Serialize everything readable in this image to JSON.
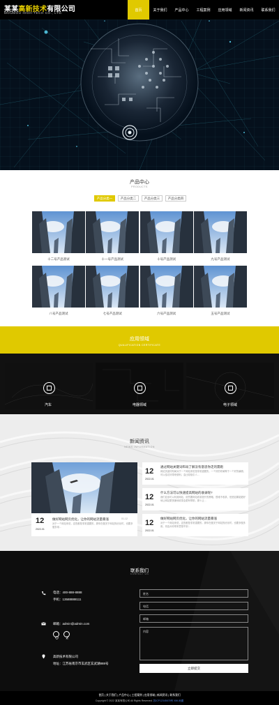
{
  "header": {
    "logo_prefix": "某某",
    "logo_highlight": "高新技术",
    "logo_suffix": "有限公司",
    "logo_sub": "MOUMOU HIGH-TECH CO., LTD.",
    "nav": [
      "首页",
      "关于我们",
      "产品中心",
      "工程案例",
      "应用领域",
      "新闻资讯",
      "联系我们"
    ],
    "active_nav_index": 0
  },
  "products": {
    "title": "产品中心",
    "subtitle": "PRODUCTS",
    "tabs": [
      "产品分类一",
      "产品分类二",
      "产品分类三",
      "产品分类四"
    ],
    "active_tab_index": 0,
    "items": [
      "十二号产品测试",
      "十一号产品测试",
      "十号产品测试",
      "九号产品测试",
      "八号产品测试",
      "七号产品测试",
      "六号产品测试",
      "五号产品测试"
    ]
  },
  "application": {
    "title": "应用领域",
    "subtitle": "QUALIFICATION CERTIFICATE",
    "items": [
      "汽车",
      "电器领域",
      "电子领域"
    ]
  },
  "news": {
    "title": "新闻资讯",
    "subtitle": "NEWS INFORMATION",
    "featured": {
      "day": "12",
      "ym": "2022-01",
      "title": "做好网站网页优化，让你的网站流量暴涨",
      "date_label": "01-12",
      "desc": "对于一个网站来说，这些都是非常重要的，那你在做关于网站的优化时，也要多做多用…"
    },
    "items": [
      {
        "day": "12",
        "ym": "2022-01",
        "title": "通过网站关键词布局了解没有意思你走的需跑",
        "desc": "网站关键词布局对于一个网站来说是非常重要的，一个好的布局等于一个好的编辑，可以给访问带来便利，会比较吸引人…"
      },
      {
        "day": "12",
        "ym": "2022-01",
        "title": "什么方法可以快速提高网站的收录呢?",
        "desc": "我们应该可以利用网站，依然要网站收录提升的策略，很难不收录，但是如果能更好地让网站更快速地收录会更有帮助，那么让…"
      },
      {
        "day": "12",
        "ym": "2022-01",
        "title": "做好网站网页优化，让你的网站流量暴涨",
        "desc": "对于一个网站来说，这些都是非常重要的，那你在做关于网站的优化时，也要多做多用，将会对你带来意想不到…"
      }
    ]
  },
  "contact": {
    "title": "联系我们",
    "subtitle": "CONTACT US",
    "phone": "电话：400-888-8888",
    "mobile": "手机：13588888111",
    "email": "邮箱：admin@admin.com",
    "company": "高新技术有限公司",
    "address": "地址：江苏省南京市玄武区玄武湖888号",
    "fields": [
      "姓名",
      "电话",
      "邮箱",
      "内容"
    ],
    "submit": "立即提交"
  },
  "footer": {
    "links": "首页 | 关于我们 | 产品中心 | 工程案例 | 应用领域 | 新闻资讯 | 联系我们",
    "copyright": "Copyright © 2022 某某有限公司 All Rights Reserved.",
    "icp": "苏ICP12345678号",
    "sitemap": "XML地图"
  },
  "colors": {
    "accent": "#e0c900",
    "dark": "#0d0d0d",
    "hero_bg": "#05101c"
  }
}
